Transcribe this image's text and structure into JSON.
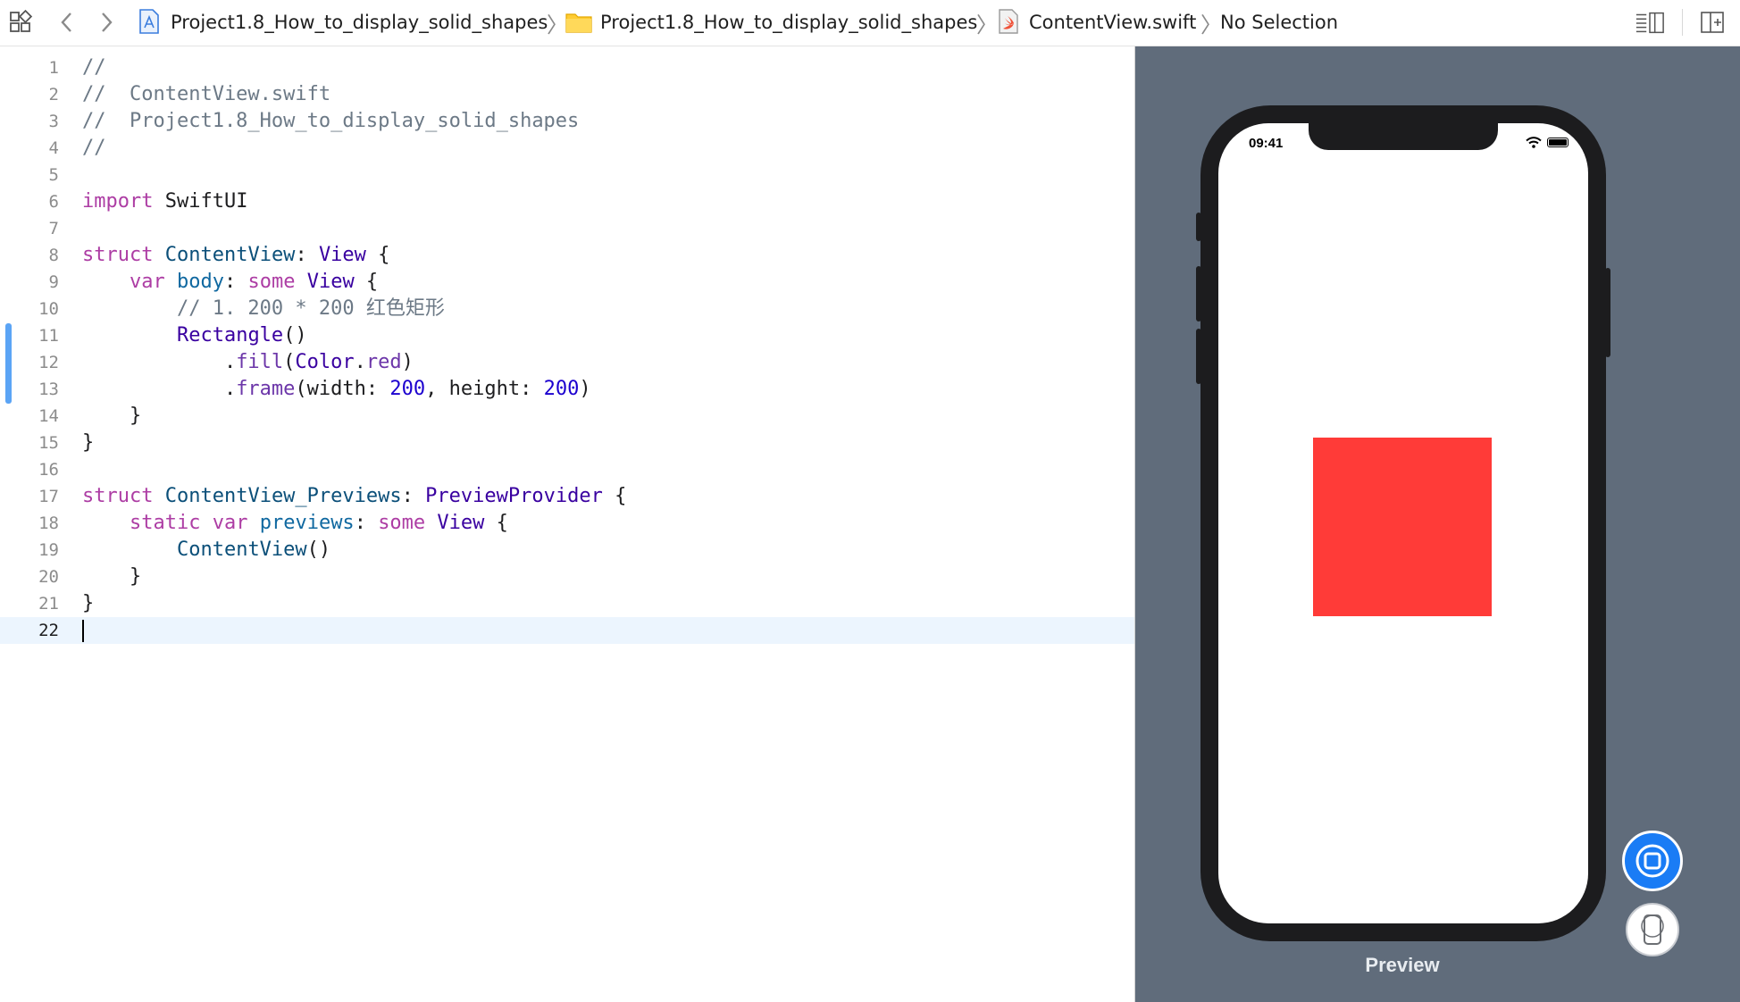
{
  "topbar": {
    "breadcrumb": [
      {
        "label": "Project1.8_How_to_display_solid_shapes",
        "icon": "xcode-project-icon"
      },
      {
        "label": "Project1.8_How_to_display_solid_shapes",
        "icon": "folder-icon"
      },
      {
        "label": "ContentView.swift",
        "icon": "swift-file-icon"
      },
      {
        "label": "No Selection"
      }
    ]
  },
  "editor": {
    "current_line": 22,
    "lines": [
      {
        "n": "1",
        "tokens": [
          {
            "t": "//",
            "c": "comment"
          }
        ]
      },
      {
        "n": "2",
        "tokens": [
          {
            "t": "//  ContentView.swift",
            "c": "comment"
          }
        ]
      },
      {
        "n": "3",
        "tokens": [
          {
            "t": "//  Project1.8_How_to_display_solid_shapes",
            "c": "comment"
          }
        ]
      },
      {
        "n": "4",
        "tokens": [
          {
            "t": "//",
            "c": "comment"
          }
        ]
      },
      {
        "n": "5",
        "tokens": []
      },
      {
        "n": "6",
        "tokens": [
          {
            "t": "import",
            "c": "keyword"
          },
          {
            "t": " SwiftUI",
            "c": "plain"
          }
        ]
      },
      {
        "n": "7",
        "tokens": []
      },
      {
        "n": "8",
        "tokens": [
          {
            "t": "struct",
            "c": "keyword"
          },
          {
            "t": " ",
            "c": "plain"
          },
          {
            "t": "ContentView",
            "c": "type-decl"
          },
          {
            "t": ": ",
            "c": "plain"
          },
          {
            "t": "View",
            "c": "type"
          },
          {
            "t": " {",
            "c": "plain"
          }
        ]
      },
      {
        "n": "9",
        "tokens": [
          {
            "t": "    ",
            "c": "plain"
          },
          {
            "t": "var",
            "c": "keyword"
          },
          {
            "t": " ",
            "c": "plain"
          },
          {
            "t": "body",
            "c": "var-decl"
          },
          {
            "t": ": ",
            "c": "plain"
          },
          {
            "t": "some",
            "c": "keyword"
          },
          {
            "t": " ",
            "c": "plain"
          },
          {
            "t": "View",
            "c": "type"
          },
          {
            "t": " {",
            "c": "plain"
          }
        ]
      },
      {
        "n": "10",
        "tokens": [
          {
            "t": "        // 1. 200 * 200 红色矩形",
            "c": "comment"
          }
        ]
      },
      {
        "n": "11",
        "tokens": [
          {
            "t": "        ",
            "c": "plain"
          },
          {
            "t": "Rectangle",
            "c": "type"
          },
          {
            "t": "()",
            "c": "plain"
          }
        ]
      },
      {
        "n": "12",
        "tokens": [
          {
            "t": "            .",
            "c": "plain"
          },
          {
            "t": "fill",
            "c": "method"
          },
          {
            "t": "(",
            "c": "plain"
          },
          {
            "t": "Color",
            "c": "type"
          },
          {
            "t": ".",
            "c": "plain"
          },
          {
            "t": "red",
            "c": "method"
          },
          {
            "t": ")",
            "c": "plain"
          }
        ]
      },
      {
        "n": "13",
        "tokens": [
          {
            "t": "            .",
            "c": "plain"
          },
          {
            "t": "frame",
            "c": "method"
          },
          {
            "t": "(width: ",
            "c": "plain"
          },
          {
            "t": "200",
            "c": "number"
          },
          {
            "t": ", height: ",
            "c": "plain"
          },
          {
            "t": "200",
            "c": "number"
          },
          {
            "t": ")",
            "c": "plain"
          }
        ]
      },
      {
        "n": "14",
        "tokens": [
          {
            "t": "    }",
            "c": "plain"
          }
        ]
      },
      {
        "n": "15",
        "tokens": [
          {
            "t": "}",
            "c": "plain"
          }
        ]
      },
      {
        "n": "16",
        "tokens": []
      },
      {
        "n": "17",
        "tokens": [
          {
            "t": "struct",
            "c": "keyword"
          },
          {
            "t": " ",
            "c": "plain"
          },
          {
            "t": "ContentView_Previews",
            "c": "type-decl"
          },
          {
            "t": ": ",
            "c": "plain"
          },
          {
            "t": "PreviewProvider",
            "c": "type"
          },
          {
            "t": " {",
            "c": "plain"
          }
        ]
      },
      {
        "n": "18",
        "tokens": [
          {
            "t": "    ",
            "c": "plain"
          },
          {
            "t": "static",
            "c": "keyword"
          },
          {
            "t": " ",
            "c": "plain"
          },
          {
            "t": "var",
            "c": "keyword"
          },
          {
            "t": " ",
            "c": "plain"
          },
          {
            "t": "previews",
            "c": "var-decl"
          },
          {
            "t": ": ",
            "c": "plain"
          },
          {
            "t": "some",
            "c": "keyword"
          },
          {
            "t": " ",
            "c": "plain"
          },
          {
            "t": "View",
            "c": "type"
          },
          {
            "t": " {",
            "c": "plain"
          }
        ]
      },
      {
        "n": "19",
        "tokens": [
          {
            "t": "        ",
            "c": "plain"
          },
          {
            "t": "ContentView",
            "c": "type-decl"
          },
          {
            "t": "()",
            "c": "plain"
          }
        ]
      },
      {
        "n": "20",
        "tokens": [
          {
            "t": "    }",
            "c": "plain"
          }
        ]
      },
      {
        "n": "21",
        "tokens": [
          {
            "t": "}",
            "c": "plain"
          }
        ]
      },
      {
        "n": "22",
        "tokens": []
      }
    ]
  },
  "preview": {
    "status_time": "09:41",
    "shape_color": "#ff3b38",
    "label": "Preview"
  },
  "colors": {
    "canvas_bg": "#606c7b",
    "accent": "#1a7cf5"
  }
}
